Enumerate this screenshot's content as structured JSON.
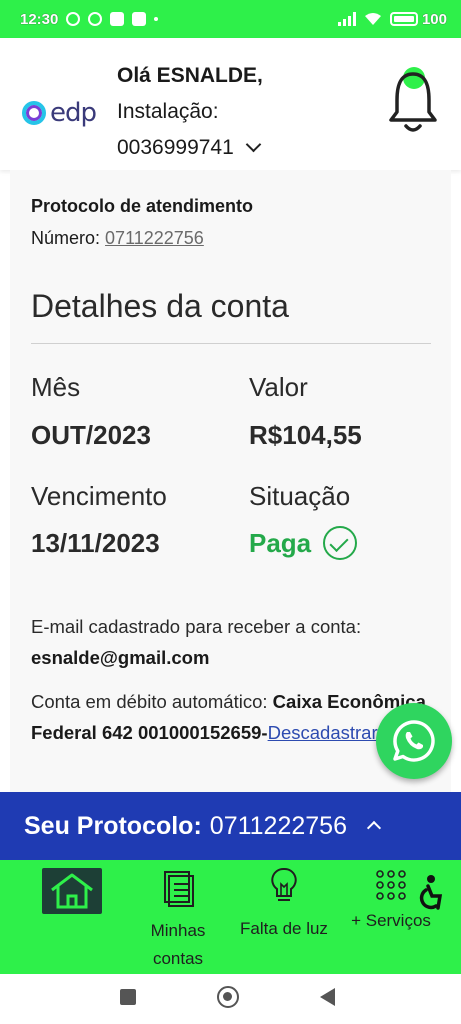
{
  "status_bar": {
    "time": "12:30",
    "battery": "100"
  },
  "header": {
    "logo_text": "edp",
    "greeting": "Olá ESNALDE,",
    "installation_label": "Instalação:",
    "installation_number": "0036999741"
  },
  "protocol": {
    "title": "Protocolo de atendimento",
    "number_label": "Número:",
    "number": "0711222756"
  },
  "account": {
    "section_title": "Detalhes da conta",
    "month_label": "Mês",
    "month_value": "OUT/2023",
    "amount_label": "Valor",
    "amount_value": "R$104,55",
    "due_label": "Vencimento",
    "due_value": "13/11/2023",
    "status_label": "Situação",
    "status_value": "Paga",
    "email_label": "E-mail cadastrado para receber a conta:",
    "email_value": "esnalde@gmail.com",
    "debit_label": "Conta em débito automático:",
    "debit_bank": "Caixa Econômica Federal 642 001000152659-",
    "debit_action": "Descadastrar"
  },
  "protocol_bar": {
    "label": "Seu Protocolo:",
    "number": "0711222756"
  },
  "bottom_nav": {
    "items": [
      {
        "label": ""
      },
      {
        "label": "Minhas contas"
      },
      {
        "label": "Falta de luz"
      },
      {
        "label": "+ Serviços"
      }
    ]
  },
  "colors": {
    "accent_green": "#2ef04a",
    "protocol_blue": "#1f3bb3",
    "paid_green": "#24a94a"
  }
}
